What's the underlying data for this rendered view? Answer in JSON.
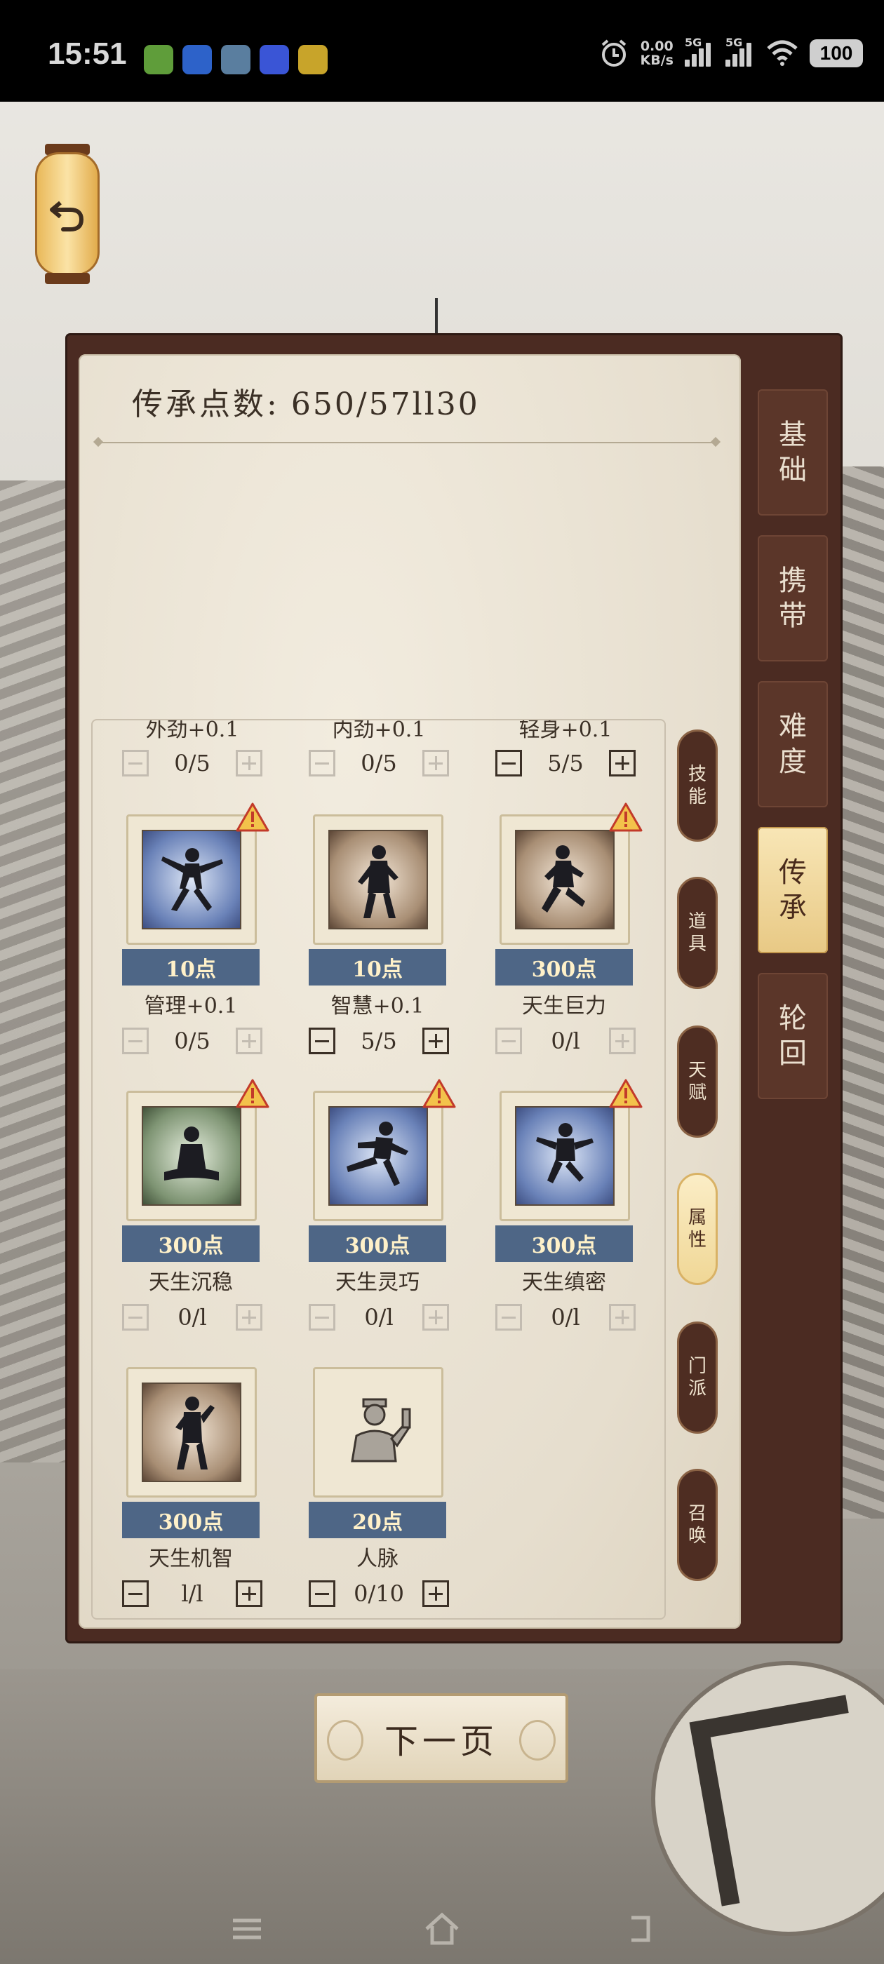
{
  "status_bar": {
    "time": "15:51",
    "net_speed_value": "0.00",
    "net_speed_unit": "KB/s",
    "signal1_label": "5G",
    "signal2_label": "5G",
    "battery": "100"
  },
  "header": {
    "points_label": "传承点数:",
    "points_value": "650/57ll30"
  },
  "main_tabs": [
    {
      "label": "基础",
      "active": false
    },
    {
      "label": "携带",
      "active": false
    },
    {
      "label": "难度",
      "active": false
    },
    {
      "label": "传承",
      "active": true
    },
    {
      "label": "轮回",
      "active": false
    }
  ],
  "sub_tabs": [
    {
      "label": "技能",
      "active": false
    },
    {
      "label": "道具",
      "active": false
    },
    {
      "label": "天赋",
      "active": false
    },
    {
      "label": "属性",
      "active": true
    },
    {
      "label": "门派",
      "active": false
    },
    {
      "label": "召唤",
      "active": false
    }
  ],
  "partial_row": [
    {
      "name": "外劲+0.1",
      "count": "0/5"
    },
    {
      "name": "内劲+0.1",
      "count": "0/5"
    },
    {
      "name": "轻身+0.1",
      "count": "5/5"
    }
  ],
  "skills": [
    {
      "name": "管理+0.1",
      "cost": "10点",
      "count": "0/5",
      "icon": "martial-pose-icon",
      "warning": true
    },
    {
      "name": "智慧+0.1",
      "cost": "10点",
      "count": "5/5",
      "icon": "martial-stance-icon",
      "warning": false
    },
    {
      "name": "天生巨力",
      "cost": "300点",
      "count": "0/l",
      "icon": "power-stance-icon",
      "warning": true
    },
    {
      "name": "天生沉稳",
      "cost": "300点",
      "count": "0/l",
      "icon": "meditation-icon",
      "warning": true
    },
    {
      "name": "天生灵巧",
      "cost": "300点",
      "count": "0/l",
      "icon": "flying-kick-icon",
      "warning": true
    },
    {
      "name": "天生缜密",
      "cost": "300点",
      "count": "0/l",
      "icon": "leap-pose-icon",
      "warning": true
    },
    {
      "name": "天生机智",
      "cost": "300点",
      "count": "l/l",
      "icon": "fist-stance-icon",
      "warning": false
    },
    {
      "name": "人脉",
      "cost": "20点",
      "count": "0/10",
      "icon": "official-figure-icon",
      "warning": false
    }
  ],
  "next_button": "下一页",
  "colors": {
    "frame": "#4b2b22",
    "paper": "#ede6d7",
    "cost_band": "#4e6686",
    "active_tab": "#f3d897",
    "warning": "#c23a2a"
  }
}
